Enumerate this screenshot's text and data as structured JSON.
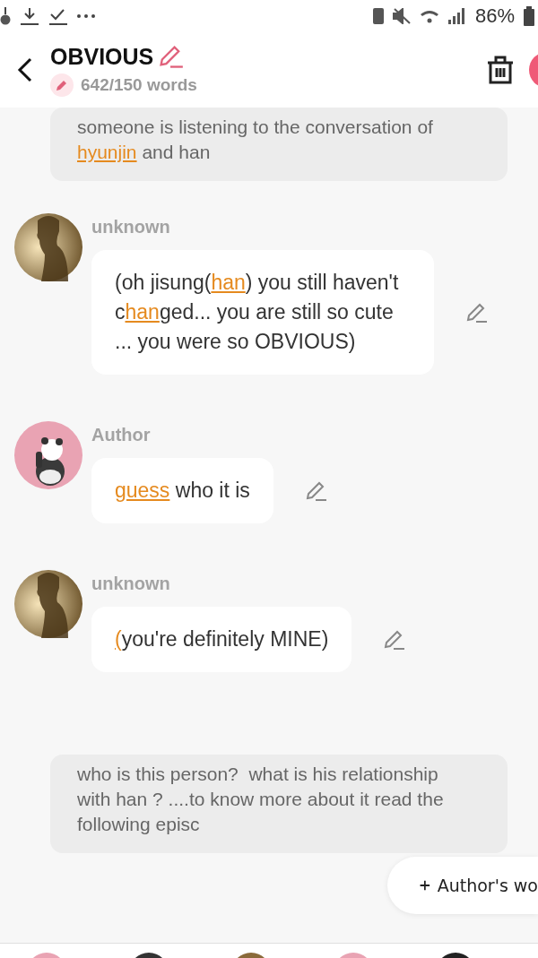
{
  "status_bar": {
    "battery": "86%"
  },
  "header": {
    "title": "OBVIOUS",
    "word_count": "642/150 words"
  },
  "items": [
    {
      "kind": "narration",
      "segments": [
        {
          "text": "someone is listening to the conversation of ",
          "flagged": false
        },
        {
          "text": "hyunjin",
          "flagged": true
        },
        {
          "text": " and han",
          "flagged": false
        }
      ]
    },
    {
      "kind": "message",
      "speaker": "unknown",
      "avatar": {
        "kind": "silhouette"
      },
      "segments": [
        {
          "text": "(oh jisung(",
          "flagged": false
        },
        {
          "text": "han",
          "flagged": true
        },
        {
          "text": ") you still haven't c",
          "flagged": false
        },
        {
          "text": "han",
          "flagged": true
        },
        {
          "text": "ged... you are still so cute ... you were so OBVIOUS)",
          "flagged": false
        }
      ]
    },
    {
      "kind": "message",
      "speaker": "Author",
      "avatar": {
        "kind": "panda"
      },
      "segments": [
        {
          "text": "guess",
          "flagged": true
        },
        {
          "text": " who it is",
          "flagged": false
        }
      ]
    },
    {
      "kind": "message",
      "speaker": "unknown",
      "avatar": {
        "kind": "silhouette"
      },
      "segments": [
        {
          "text": "(",
          "flagged": true
        },
        {
          "text": "you're definitely MINE)",
          "flagged": false
        }
      ]
    },
    {
      "kind": "narration",
      "segments": [
        {
          "text": "who is this person?  what is his relationship with han ? ....to know more about it read the following episc",
          "flagged": false
        }
      ]
    }
  ],
  "floating_button": {
    "label": "Author's wo"
  }
}
